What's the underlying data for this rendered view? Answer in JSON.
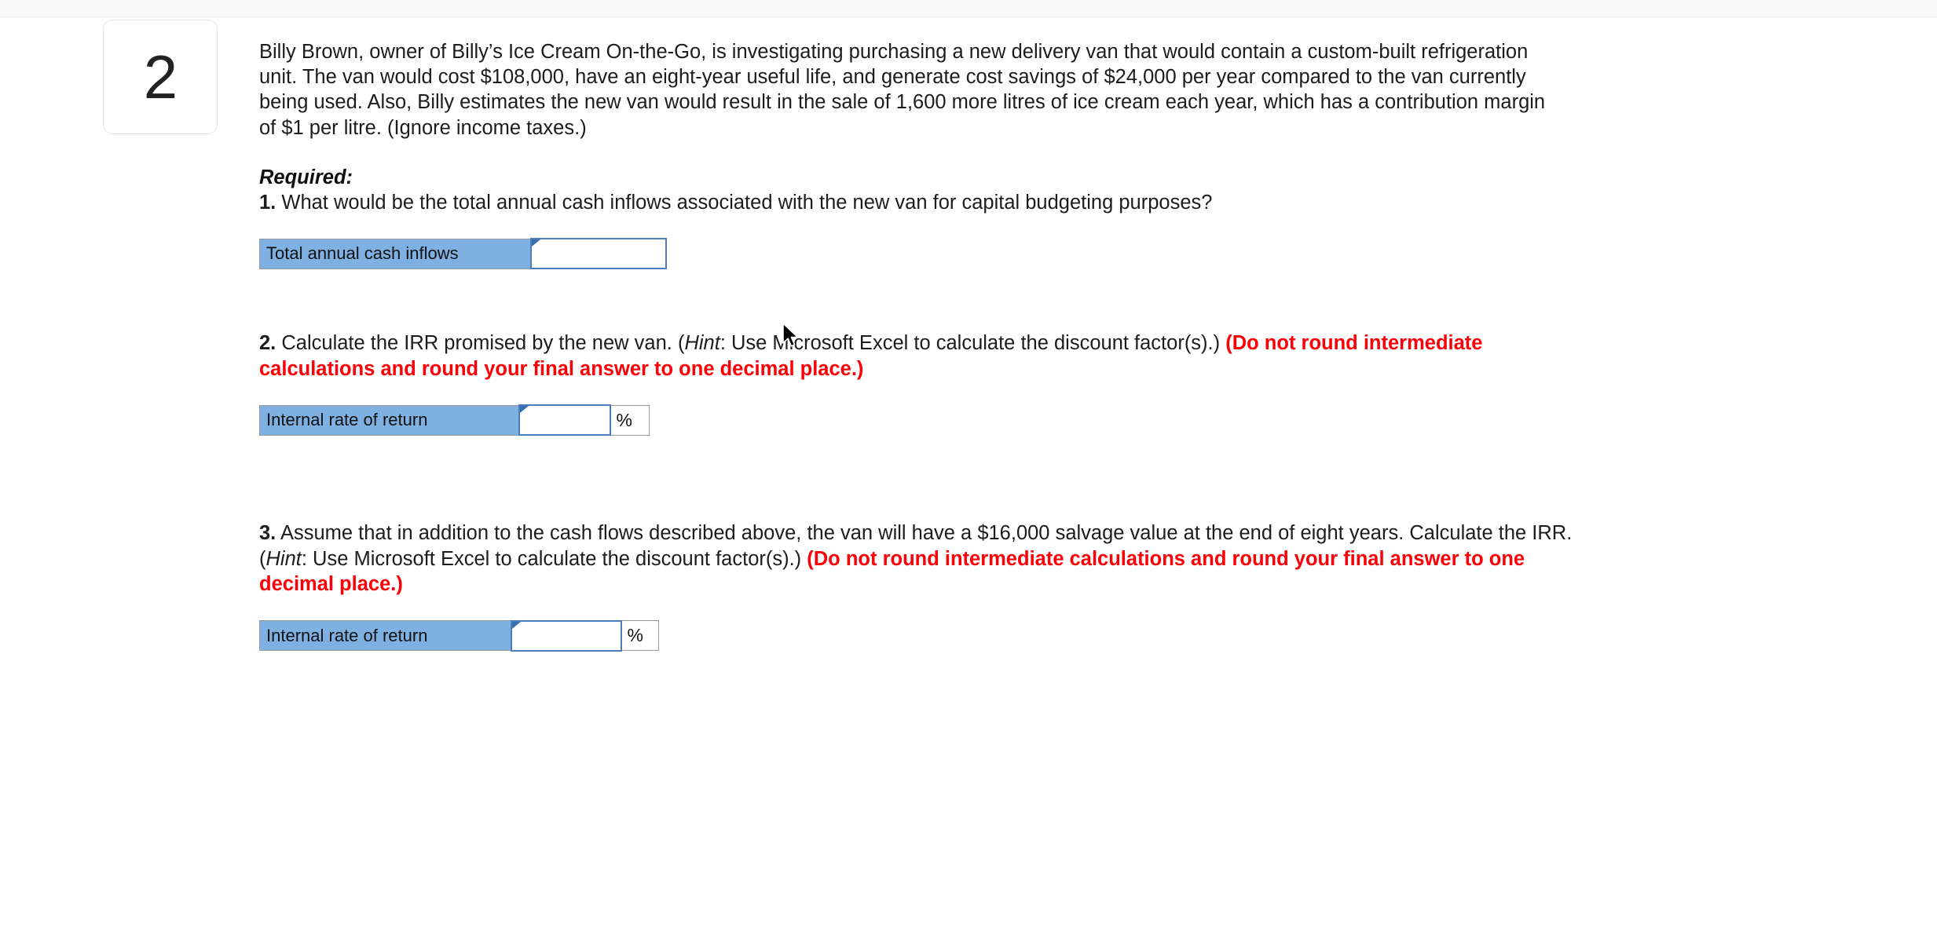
{
  "window": {
    "top_strip_color": "#fafafa"
  },
  "question": {
    "number": "2",
    "stem": "Billy Brown, owner of Billy’s Ice Cream On-the-Go, is investigating purchasing a new delivery van that would contain a custom-built refrigeration unit. The van would cost $108,000, have an eight-year useful life, and generate cost savings of $24,000 per year compared to the van currently being used. Also, Billy estimates the new van would result in the sale of 1,600 more litres of ice cream each year, which has a contribution margin of $1 per litre. (Ignore income taxes.)",
    "required_label": "Required:"
  },
  "parts": {
    "p1": {
      "number": "1.",
      "text": "What would be the total annual cash inflows associated with the new van for capital budgeting purposes?",
      "row_label": "Total annual cash inflows",
      "input_value": "",
      "input_placeholder": ""
    },
    "p2": {
      "number": "2.",
      "text_before_hint": "Calculate the IRR promised by the new van. (",
      "hint_word": "Hint",
      "text_after_hint": ": Use Microsoft Excel to calculate the discount factor(s).) ",
      "emphasis": "(Do not round intermediate calculations and round your final answer to one decimal place.)",
      "row_label": "Internal rate of return",
      "input_value": "",
      "input_placeholder": "",
      "unit": "%"
    },
    "p3": {
      "number": "3.",
      "text_before_hint": "Assume that in addition to the cash flows described above, the van will have a $16,000 salvage value at the end of eight years. Calculate the IRR. (",
      "hint_word": "Hint",
      "text_after_hint": ": Use Microsoft Excel to calculate the discount factor(s).) ",
      "emphasis": "(Do not round intermediate calculations and round your final answer to one decimal place.)",
      "row_label": "Internal rate of return",
      "input_value": "",
      "input_placeholder": "",
      "unit": "%"
    }
  },
  "colors": {
    "header_blue": "#7FB0E2",
    "input_border_blue": "#4a7ebb",
    "emphasis_red": "#fb0007",
    "cell_border_gray": "#9a9a9a"
  }
}
